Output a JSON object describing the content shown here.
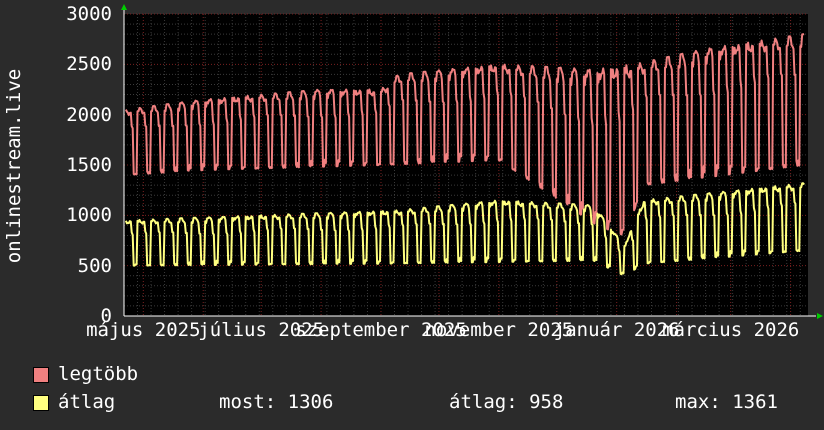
{
  "chart_data": {
    "type": "line",
    "ylabel": "onlinestream.live",
    "ylim": [
      0,
      3000
    ],
    "yticks": [
      0,
      500,
      1000,
      1500,
      2000,
      2500,
      3000
    ],
    "ytick_labels": [
      "0",
      "500",
      "1000",
      "1500",
      "2000",
      "2500",
      "3000"
    ],
    "xlim": [
      "2025-04-21",
      "2026-04-10"
    ],
    "xticks": [
      {
        "label": "május 2025",
        "date": "2025-05-01"
      },
      {
        "label": "július 2025",
        "date": "2025-07-01"
      },
      {
        "label": "szeptember 2025",
        "date": "2025-09-01"
      },
      {
        "label": "november 2025",
        "date": "2025-11-01"
      },
      {
        "label": "január 2026",
        "date": "2026-01-01"
      },
      {
        "label": "március 2026",
        "date": "2026-03-01"
      }
    ],
    "grid": true,
    "series": [
      {
        "name": "legtöbb",
        "color": "#f08080",
        "weekly_peak": [
          {
            "date": "2025-04-22",
            "value": 2050
          },
          {
            "date": "2025-06-01",
            "value": 2150
          },
          {
            "date": "2025-08-01",
            "value": 2250
          },
          {
            "date": "2025-09-01",
            "value": 2250
          },
          {
            "date": "2025-09-10",
            "value": 2400
          },
          {
            "date": "2025-11-01",
            "value": 2500
          },
          {
            "date": "2025-12-20",
            "value": 2450
          },
          {
            "date": "2026-01-10",
            "value": 2500
          },
          {
            "date": "2026-02-15",
            "value": 2650
          },
          {
            "date": "2026-04-08",
            "value": 2800
          }
        ],
        "weekly_low": [
          {
            "date": "2025-04-22",
            "value": 1400
          },
          {
            "date": "2025-06-01",
            "value": 1450
          },
          {
            "date": "2025-09-01",
            "value": 1500
          },
          {
            "date": "2025-11-01",
            "value": 1550
          },
          {
            "date": "2025-12-22",
            "value": 900
          },
          {
            "date": "2026-01-05",
            "value": 800
          },
          {
            "date": "2026-01-15",
            "value": 1300
          },
          {
            "date": "2026-04-08",
            "value": 1500
          }
        ]
      },
      {
        "name": "átlag",
        "color": "#ffff80",
        "weekly_peak": [
          {
            "date": "2025-04-22",
            "value": 950
          },
          {
            "date": "2025-07-01",
            "value": 1000
          },
          {
            "date": "2025-09-10",
            "value": 1050
          },
          {
            "date": "2025-11-01",
            "value": 1150
          },
          {
            "date": "2025-12-20",
            "value": 1100
          },
          {
            "date": "2026-01-05",
            "value": 700
          },
          {
            "date": "2026-01-15",
            "value": 1150
          },
          {
            "date": "2026-04-08",
            "value": 1320
          }
        ],
        "weekly_low": [
          {
            "date": "2025-04-22",
            "value": 500
          },
          {
            "date": "2025-09-01",
            "value": 520
          },
          {
            "date": "2025-12-20",
            "value": 550
          },
          {
            "date": "2026-01-05",
            "value": 400
          },
          {
            "date": "2026-01-15",
            "value": 520
          },
          {
            "date": "2026-04-08",
            "value": 650
          }
        ]
      }
    ]
  },
  "legend": {
    "items": [
      {
        "label": "legtöbb",
        "color": "#f08080"
      },
      {
        "label": "átlag",
        "color": "#ffff80"
      }
    ],
    "stats": {
      "most": "most: 1306",
      "atlag": "átlag: 958",
      "max": "max: 1361"
    }
  }
}
